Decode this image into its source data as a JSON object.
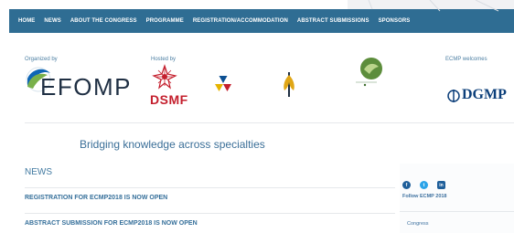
{
  "nav": {
    "items": [
      "HOME",
      "NEWS",
      "ABOUT THE CONGRESS",
      "PROGRAMME",
      "REGISTRATION/ACCOMMODATION",
      "ABSTRACT SUBMISSIONS",
      "SPONSORS"
    ]
  },
  "logos": {
    "organized_label": "Organized by",
    "hosted_label": "Hosted by",
    "welcomes_label": "ECMP welcomes",
    "efomp": "EFOMP",
    "dsmf": "DSMF",
    "dgmp": "DGMP"
  },
  "main": {
    "tagline": "Bridging knowledge across specialties",
    "news_heading": "NEWS",
    "news_items": [
      "REGISTRATION FOR ECMP2018 IS NOW OPEN",
      "ABSTRACT SUBMISSION FOR ECMP2018 IS NOW OPEN"
    ]
  },
  "sidebar": {
    "follow": "Follow ECMP 2018",
    "congress": "Congress"
  },
  "colors": {
    "nav_bg": "#2f6d93",
    "accent": "#427aa1",
    "dsmf_red": "#c41f2d",
    "dgmp_blue": "#0c3f7a"
  }
}
